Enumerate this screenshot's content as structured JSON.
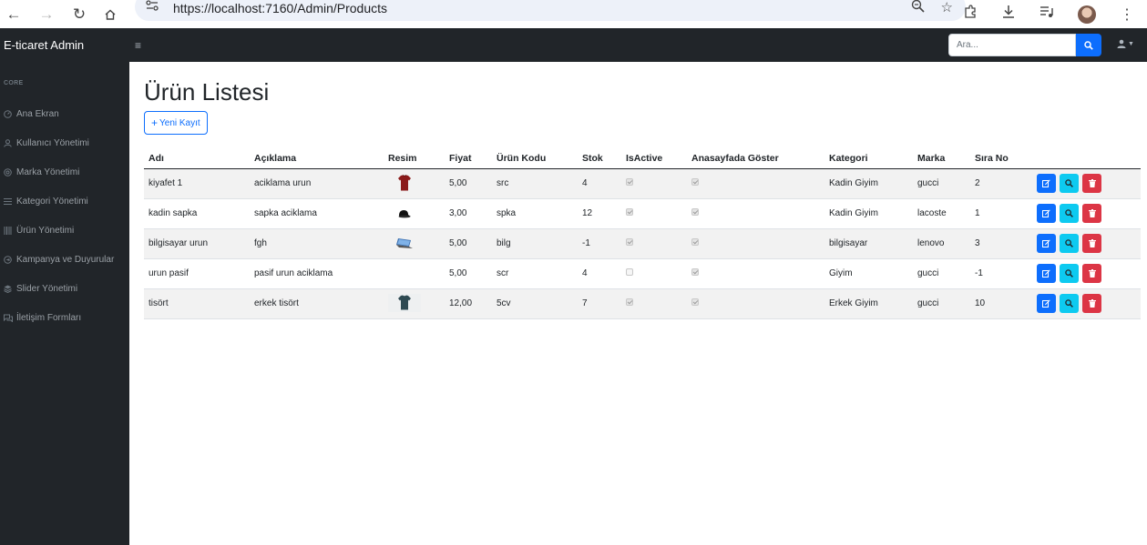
{
  "browser": {
    "url": "https://localhost:7160/Admin/Products"
  },
  "navbar": {
    "brand": "E-ticaret Admin",
    "toggle": "≡",
    "search_placeholder": "Ara..."
  },
  "sidebar": {
    "heading": "CORE",
    "items": [
      {
        "label": "Ana Ekran",
        "icon": "gauge-icon"
      },
      {
        "label": "Kullanıcı Yönetimi",
        "icon": "user-icon"
      },
      {
        "label": "Marka Yönetimi",
        "icon": "circle-icon"
      },
      {
        "label": "Kategori Yönetimi",
        "icon": "list-icon"
      },
      {
        "label": "Ürün Yönetimi",
        "icon": "barcode-icon"
      },
      {
        "label": "Kampanya ve Duyurular",
        "icon": "megaphone-icon"
      },
      {
        "label": "Slider Yönetimi",
        "icon": "layers-icon"
      },
      {
        "label": "İletişim Formları",
        "icon": "chat-icon"
      }
    ]
  },
  "page": {
    "title": "Ürün Listesi",
    "new_button": "Yeni Kayıt"
  },
  "table": {
    "headers": [
      "Adı",
      "Açıklama",
      "Resim",
      "Fiyat",
      "Ürün Kodu",
      "Stok",
      "IsActive",
      "Anasayfada Göster",
      "Kategori",
      "Marka",
      "Sıra No",
      ""
    ],
    "rows": [
      {
        "name": "kiyafet 1",
        "desc": "aciklama urun",
        "image": "shirt-red",
        "price": "5,00",
        "code": "src",
        "stock": "4",
        "active": true,
        "home": true,
        "category": "Kadin Giyim",
        "brand": "gucci",
        "order": "2"
      },
      {
        "name": "kadin sapka",
        "desc": "sapka aciklama",
        "image": "cap-black",
        "price": "3,00",
        "code": "spka",
        "stock": "12",
        "active": true,
        "home": true,
        "category": "Kadin Giyim",
        "brand": "lacoste",
        "order": "1"
      },
      {
        "name": "bilgisayar urun",
        "desc": "fgh",
        "image": "laptop",
        "price": "5,00",
        "code": "bilg",
        "stock": "-1",
        "active": true,
        "home": true,
        "category": "bilgisayar",
        "brand": "lenovo",
        "order": "3"
      },
      {
        "name": "urun pasif",
        "desc": "pasif urun aciklama",
        "image": "",
        "price": "5,00",
        "code": "scr",
        "stock": "4",
        "active": false,
        "home": true,
        "category": "Giyim",
        "brand": "gucci",
        "order": "-1"
      },
      {
        "name": "tisört",
        "desc": "erkek tisört",
        "image": "tshirt-dark",
        "price": "12,00",
        "code": "5cv",
        "stock": "7",
        "active": true,
        "home": true,
        "category": "Erkek Giyim",
        "brand": "gucci",
        "order": "10"
      }
    ]
  },
  "colors": {
    "primary": "#0d6efd",
    "info": "#0dcaf0",
    "danger": "#dc3545",
    "dark": "#212529"
  }
}
